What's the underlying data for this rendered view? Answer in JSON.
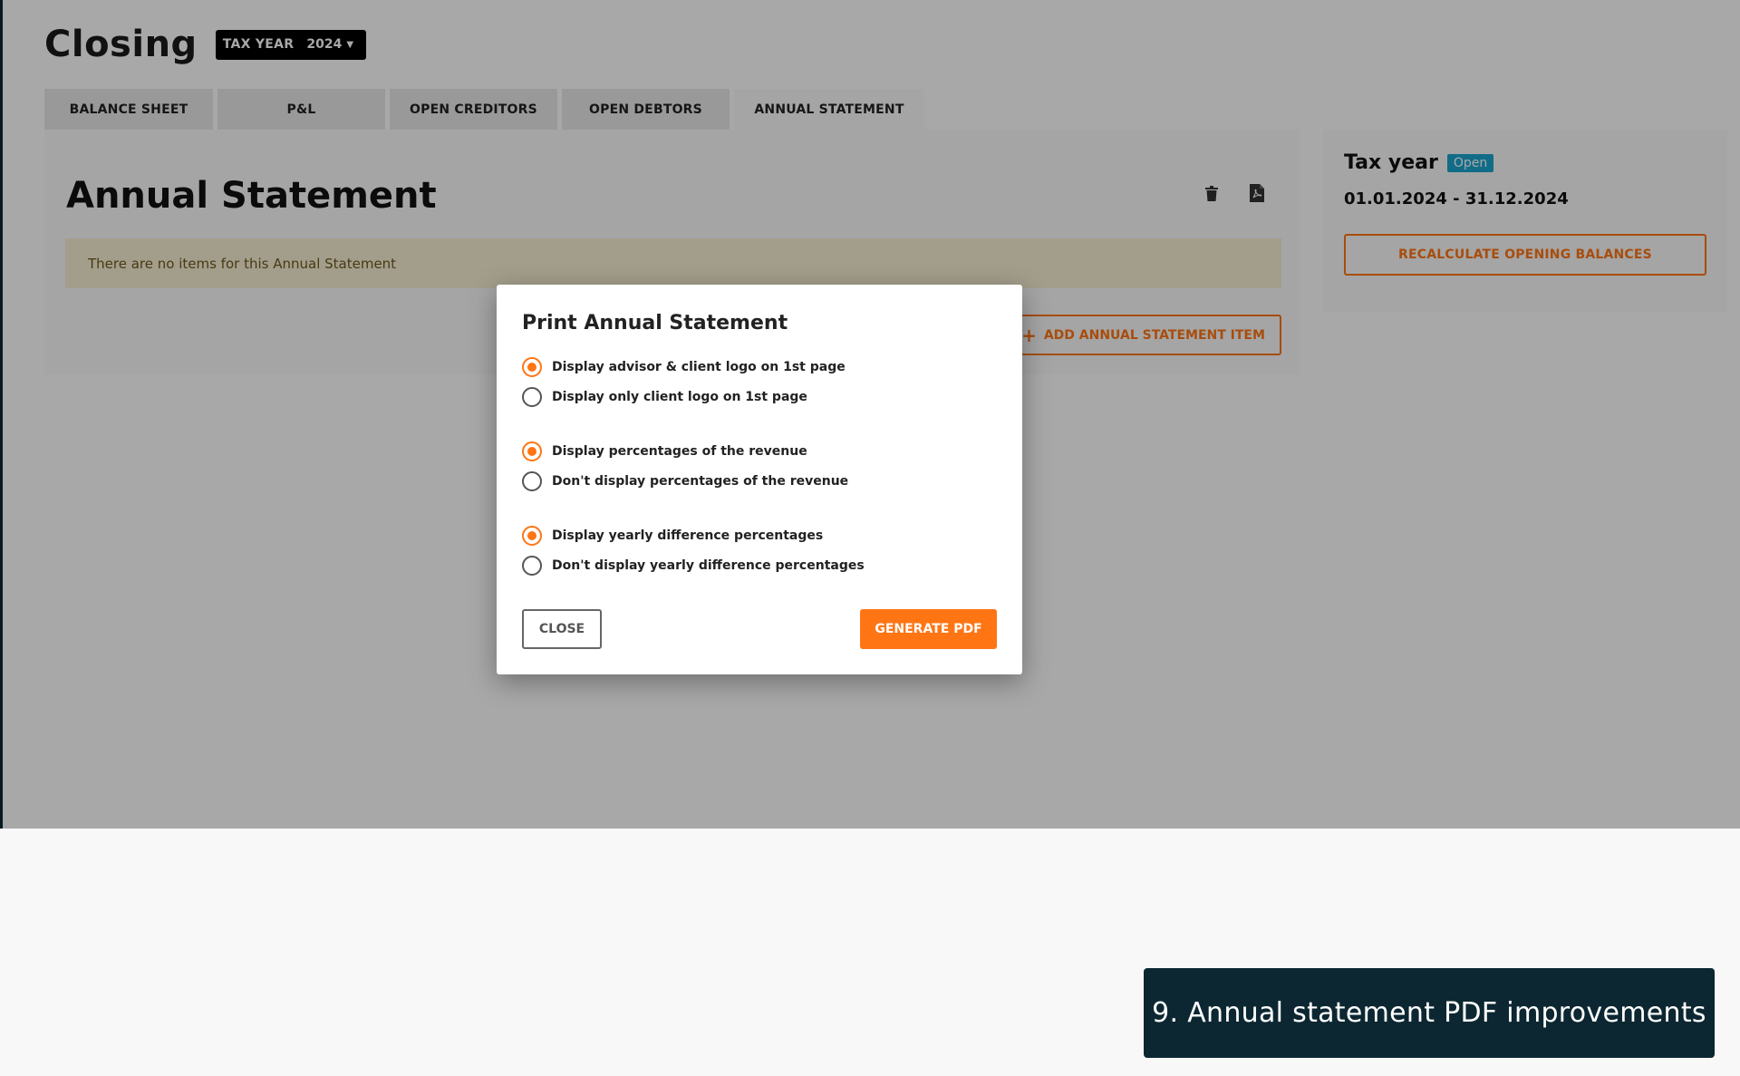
{
  "header": {
    "title": "Closing",
    "tax_year_label": "TAX YEAR",
    "tax_year_value": "2024"
  },
  "tabs": [
    {
      "label": "BALANCE SHEET",
      "active": false
    },
    {
      "label": "P&L",
      "active": false
    },
    {
      "label": "OPEN CREDITORS",
      "active": false
    },
    {
      "label": "OPEN DEBTORS",
      "active": false
    },
    {
      "label": "ANNUAL STATEMENT",
      "active": true
    }
  ],
  "main": {
    "title": "Annual Statement",
    "empty_alert": "There are no items for this Annual Statement",
    "add_button": "ADD ANNUAL STATEMENT ITEM",
    "icons": [
      "trash-icon",
      "pdf-file-icon"
    ]
  },
  "side": {
    "title": "Tax year",
    "status_badge": "Open",
    "date_range": "01.01.2024 - 31.12.2024",
    "recalc_button": "RECALCULATE OPENING BALANCES"
  },
  "modal": {
    "title": "Print Annual Statement",
    "groups": [
      {
        "options": [
          {
            "label": "Display advisor & client logo on 1st page",
            "checked": true
          },
          {
            "label": "Display only client logo on 1st page",
            "checked": false
          }
        ]
      },
      {
        "options": [
          {
            "label": "Display percentages of the revenue",
            "checked": true
          },
          {
            "label": "Don't display percentages of the revenue",
            "checked": false
          }
        ]
      },
      {
        "options": [
          {
            "label": "Display yearly difference percentages",
            "checked": true
          },
          {
            "label": "Don't display yearly difference percentages",
            "checked": false
          }
        ]
      }
    ],
    "close_button": "CLOSE",
    "generate_button": "GENERATE PDF"
  },
  "caption": "9. Annual statement PDF improvements",
  "colors": {
    "accent": "#ff7514",
    "badge": "#1aa4cf",
    "caption_bg": "#0c2731"
  }
}
